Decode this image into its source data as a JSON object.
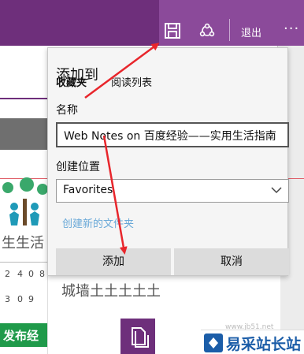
{
  "toolbar": {
    "save_icon": "save-icon",
    "share_icon": "share-icon",
    "exit_label": "退出",
    "more_label": "···"
  },
  "popup": {
    "title": "添加到",
    "tabs": [
      {
        "label": "收藏夹",
        "active": true
      },
      {
        "label": "阅读列表",
        "active": false
      }
    ],
    "name_label": "名称",
    "name_value": "Web Notes on 百度经验——实用生活指南",
    "location_label": "创建位置",
    "location_value": "Favorites",
    "new_folder_label": "创建新的文件夹",
    "add_button": "添加",
    "cancel_button": "取消"
  },
  "background": {
    "life_text": "生生活",
    "grid_numbers": [
      "2",
      "4",
      "0",
      "8",
      "3",
      "0",
      "9"
    ],
    "publish_label": "发布经",
    "city_text": "城墙土土土土土"
  },
  "watermark": {
    "text": "易采站长站",
    "url": "www.jb51.net"
  },
  "colors": {
    "toolbar": "#6e2f7b",
    "arrow": "#e8262c",
    "link": "#6aa9d8"
  }
}
